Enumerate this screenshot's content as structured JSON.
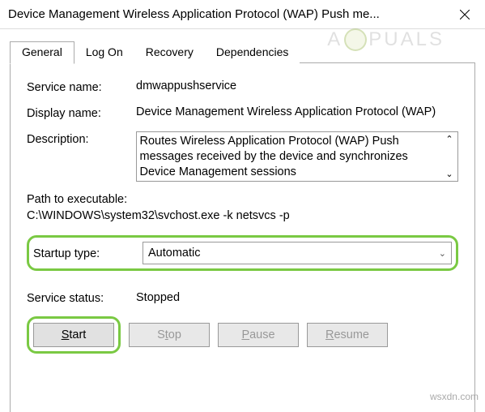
{
  "window": {
    "title": "Device Management Wireless Application Protocol (WAP) Push me..."
  },
  "tabs": {
    "t0": "General",
    "t1": "Log On",
    "t2": "Recovery",
    "t3": "Dependencies"
  },
  "fields": {
    "service_name_label": "Service name:",
    "service_name_value": "dmwappushservice",
    "display_name_label": "Display name:",
    "display_name_value": "Device Management Wireless Application Protocol (WAP)",
    "description_label": "Description:",
    "description_value": "Routes Wireless Application Protocol (WAP) Push messages received by the device and synchronizes Device Management sessions",
    "path_label": "Path to executable:",
    "path_value": "C:\\WINDOWS\\system32\\svchost.exe -k netsvcs -p",
    "startup_label": "Startup type:",
    "startup_value": "Automatic",
    "status_label": "Service status:",
    "status_value": "Stopped"
  },
  "buttons": {
    "start_prefix": "",
    "start_u": "S",
    "start_suffix": "tart",
    "stop_prefix": "S",
    "stop_u": "t",
    "stop_suffix": "op",
    "pause_prefix": "",
    "pause_u": "P",
    "pause_suffix": "ause",
    "resume_prefix": "",
    "resume_u": "R",
    "resume_suffix": "esume"
  },
  "watermark": {
    "prefix": "A",
    "suffix": "PUALS",
    "footer": "wsxdn.com"
  }
}
